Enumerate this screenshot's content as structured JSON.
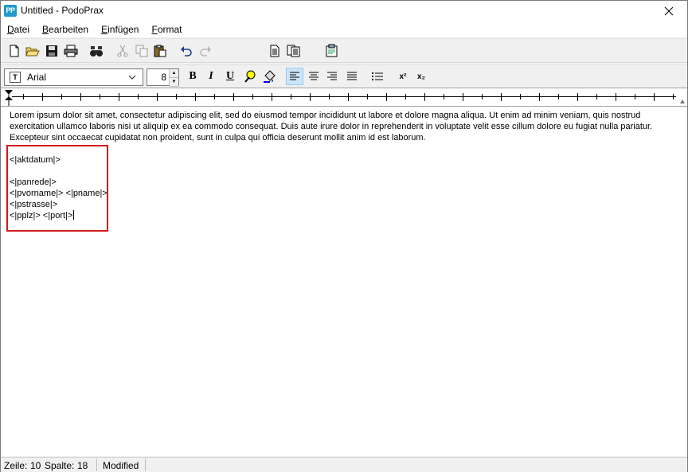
{
  "window": {
    "logo_text": "PP",
    "title": "Untitled - PodoPrax"
  },
  "menu": {
    "items": [
      {
        "accel": "D",
        "rest": "atei"
      },
      {
        "accel": "B",
        "rest": "earbeiten"
      },
      {
        "accel": "E",
        "rest": "infügen"
      },
      {
        "accel": "F",
        "rest": "ormat"
      }
    ]
  },
  "toolbar": {
    "icons": [
      "new-document-icon",
      "open-folder-icon",
      "save-icon",
      "print-icon",
      "find-icon",
      "cut-icon",
      "copy-icon",
      "paste-icon",
      "undo-icon",
      "redo-icon",
      "insert-page-icon",
      "insert-multiple-pages-icon",
      "insert-field-icon"
    ]
  },
  "format": {
    "font_name": "Arial",
    "font_icon": "T",
    "font_size": "8",
    "bold": "B",
    "italic": "I",
    "underline": "U",
    "superscript": "x²",
    "subscript": "x₂"
  },
  "editor": {
    "lorem": "Lorem ipsum dolor sit amet, consectetur adipiscing elit, sed do eiusmod tempor incididunt ut labore et dolore magna aliqua. Ut enim ad minim veniam, quis nostrud exercitation ullamco laboris nisi ut aliquip ex ea commodo consequat. Duis aute irure dolor in reprehenderit in voluptate velit esse cillum dolore eu fugiat nulla pariatur. Excepteur sint occaecat cupidatat non proident, sunt in culpa qui officia deserunt mollit anim id est laborum.",
    "lines": [
      "<|aktdatum|>",
      "",
      "<|panrede|>",
      "<|pvorname|> <|pname|>",
      "<|pstrasse|>",
      "<|pplz|> <|port|>"
    ]
  },
  "status": {
    "zeile_label": "Zeile:",
    "zeile_value": "10",
    "spalte_label": "Spalte:",
    "spalte_value": "18",
    "modified": "Modified"
  },
  "colors": {
    "accent_selected": "#cce4f7",
    "highlight_border": "#d01818",
    "logo": "#1f9ac9"
  }
}
